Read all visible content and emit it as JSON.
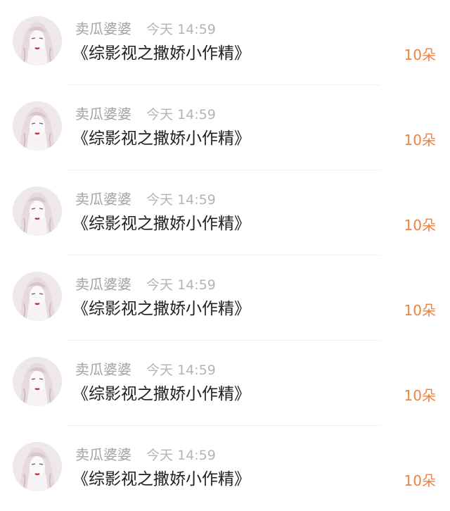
{
  "messages": [
    {
      "user": "卖瓜婆婆",
      "time": "今天 14:59",
      "text": "《综影视之撒娇小作精》",
      "gift": "10朵"
    },
    {
      "user": "卖瓜婆婆",
      "time": "今天 14:59",
      "text": "《综影视之撒娇小作精》",
      "gift": "10朵"
    },
    {
      "user": "卖瓜婆婆",
      "time": "今天 14:59",
      "text": "《综影视之撒娇小作精》",
      "gift": "10朵"
    },
    {
      "user": "卖瓜婆婆",
      "time": "今天 14:59",
      "text": "《综影视之撒娇小作精》",
      "gift": "10朵"
    },
    {
      "user": "卖瓜婆婆",
      "time": "今天 14:59",
      "text": "《综影视之撒娇小作精》",
      "gift": "10朵"
    },
    {
      "user": "卖瓜婆婆",
      "time": "今天 14:59",
      "text": "《综影视之撒娇小作精》",
      "gift": "10朵"
    }
  ],
  "colors": {
    "gift": "#f0823e",
    "name": "#a3a3a3",
    "message": "#1f1f1f"
  },
  "icons": {
    "avatar": "avatar-portrait-icon"
  }
}
